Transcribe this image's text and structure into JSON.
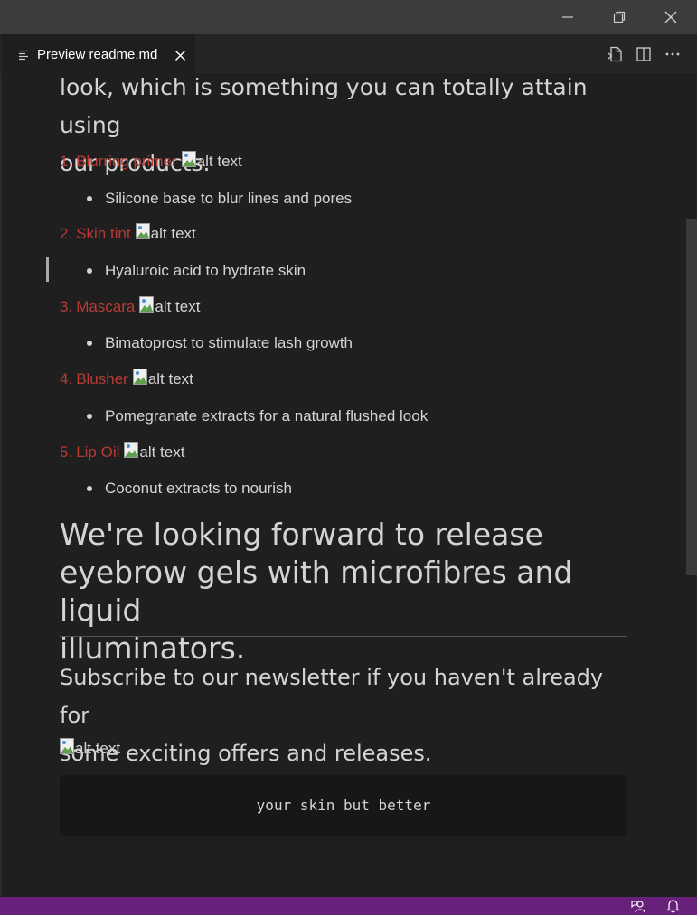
{
  "window": {
    "controls": {
      "minimize_icon": "minimize-icon",
      "restore_icon": "restore-icon",
      "close_icon": "close-icon"
    }
  },
  "tab": {
    "label": "Preview readme.md",
    "icon": "preview-icon",
    "close_icon": "close-icon"
  },
  "editor_actions": {
    "open_source_icon": "open-source-icon",
    "split_editor_icon": "split-editor-icon",
    "more_actions_icon": "more-actions-icon"
  },
  "preview": {
    "intro_lines": [
      "look, which is something you can totally attain using",
      "our products."
    ],
    "products": [
      {
        "number": "1.",
        "name": "Blurring primer",
        "image_alt": "alt text",
        "detail": "Silicone base to blur lines and pores"
      },
      {
        "number": "2.",
        "name": "Skin tint",
        "image_alt": "alt text",
        "detail": "Hyaluroic acid to hydrate skin"
      },
      {
        "number": "3.",
        "name": "Mascara",
        "image_alt": "alt text",
        "detail": "Bimatoprost to stimulate lash growth"
      },
      {
        "number": "4.",
        "name": "Blusher",
        "image_alt": "alt text",
        "detail": "Pomegranate extracts for a natural flushed look"
      },
      {
        "number": "5.",
        "name": "Lip Oil",
        "image_alt": "alt text",
        "detail": "Coconut extracts to nourish"
      }
    ],
    "heading_lines": [
      "We're looking forward to release",
      "eyebrow gels with microfibres and liquid",
      "illuminators."
    ],
    "subscribe_lines": [
      "Subscribe to our newsletter if you haven't already for",
      "some exciting offers and releases."
    ],
    "footer_image_alt": "alt text",
    "code": "your skin but better"
  },
  "statusbar": {
    "feedback_icon": "feedback-icon",
    "notifications_icon": "bell-icon",
    "color": "#68217a"
  },
  "colors": {
    "list_accent": "#b73a34",
    "editor_bg": "#1f1f1f",
    "titlebar_bg": "#3c3c3c"
  }
}
